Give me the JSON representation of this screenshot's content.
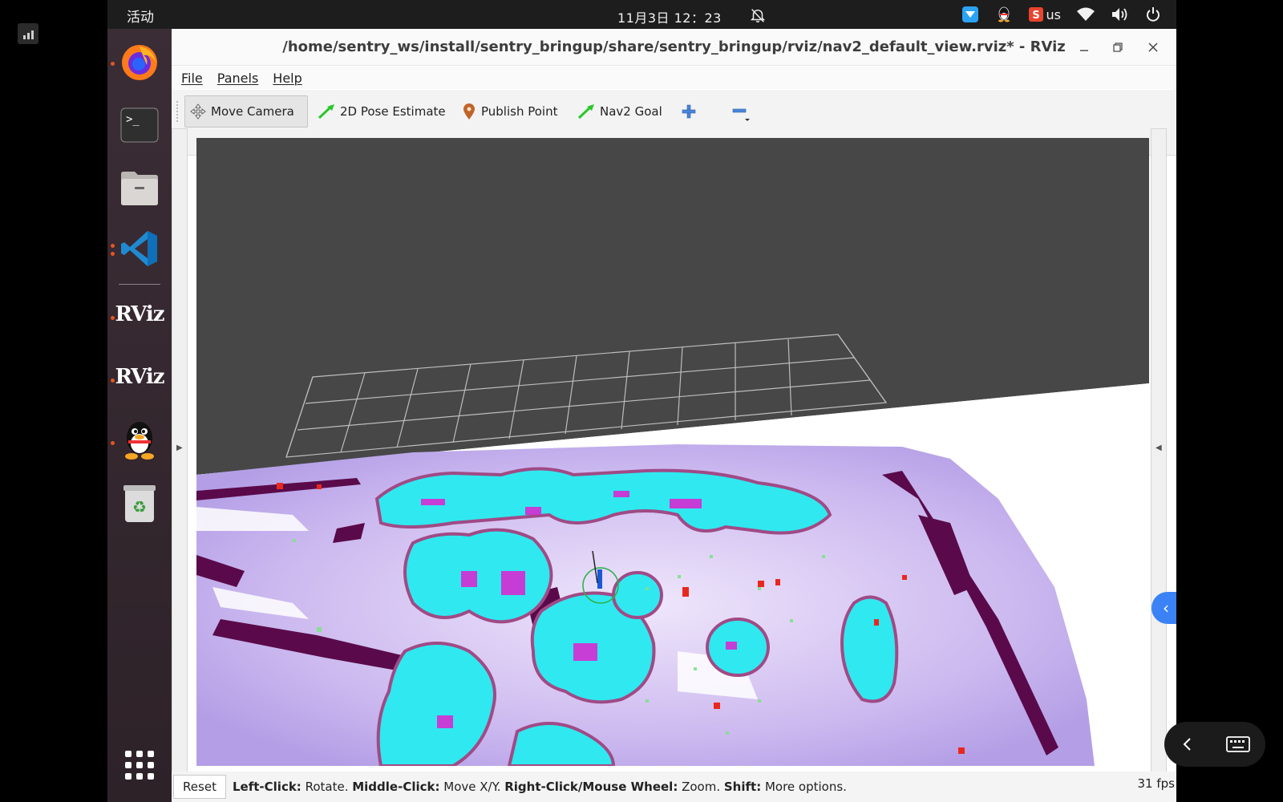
{
  "system": {
    "activities_label": "活动",
    "clock": "11月3日  12：23",
    "input_method": "us"
  },
  "dock": {
    "apps": [
      {
        "name": "Firefox",
        "icon": "firefox-icon",
        "running": true
      },
      {
        "name": "Terminal",
        "icon": "terminal-icon",
        "running": false
      },
      {
        "name": "Files",
        "icon": "files-icon",
        "running": false
      },
      {
        "name": "Visual Studio Code",
        "icon": "vscode-icon",
        "running": true
      },
      {
        "name": "RViz",
        "icon": "rviz-icon",
        "label": "RViz",
        "running": true
      },
      {
        "name": "RViz",
        "icon": "rviz-icon",
        "label": "RViz",
        "running": true
      },
      {
        "name": "QQ",
        "icon": "qq-penguin-icon",
        "running": true
      },
      {
        "name": "Trash",
        "icon": "trash-icon",
        "running": false
      }
    ],
    "show_apps_icon": "apps-grid-icon"
  },
  "window": {
    "title": "/home/sentry_ws/install/sentry_bringup/share/sentry_bringup/rviz/nav2_default_view.rviz* - RViz",
    "menu": [
      "File",
      "Panels",
      "Help"
    ],
    "tools": {
      "move_camera": "Move Camera",
      "pose_estimate": "2D Pose Estimate",
      "publish_point": "Publish Point",
      "nav2_goal": "Nav2 Goal"
    },
    "status": {
      "reset": "Reset",
      "left_click_key": "Left-Click:",
      "left_click_val": " Rotate. ",
      "middle_click_key": "Middle-Click:",
      "middle_click_val": " Move X/Y. ",
      "right_click_key": "Right-Click/Mouse Wheel:",
      "right_click_val": " Zoom. ",
      "shift_key": "Shift:",
      "shift_val": " More options."
    },
    "fps": "31 fps"
  },
  "colors": {
    "viewport_background": "#474747",
    "costmap_cyan": "#30e8f0",
    "costmap_magenta": "#e020d0",
    "costmap_lavender": "#c9b8ee",
    "obstacle_purple": "#5a0a4a",
    "accent": "#e95420"
  }
}
